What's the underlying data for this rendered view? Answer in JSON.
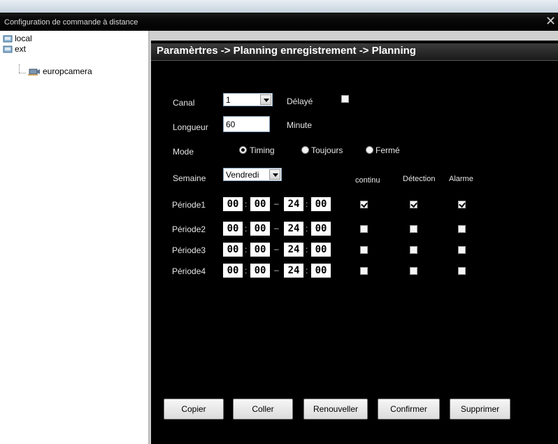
{
  "window": {
    "title": "Configuration de commande à distance",
    "close_glyph": "✕"
  },
  "tree": {
    "items": [
      {
        "label": "local",
        "icon": "folder-device-icon"
      },
      {
        "label": "ext",
        "icon": "folder-device-icon"
      },
      {
        "label": "europcamera",
        "icon": "camera-icon"
      }
    ]
  },
  "header": {
    "title": "Paramèrtres -> Planning enregistrement -> Planning"
  },
  "form": {
    "canal_label": "Canal",
    "canal_value": "1",
    "delaye_label": "Délayé",
    "delaye_checked": false,
    "longueur_label": "Longueur",
    "longueur_value": "60",
    "minute_label": "Minute",
    "mode_label": "Mode",
    "mode_options": [
      "Timing",
      "Toujours",
      "Fermé"
    ],
    "mode_selected": "Timing",
    "semaine_label": "Semaine",
    "semaine_value": "Vendredi"
  },
  "columns": {
    "continu": "continu",
    "detection": "Détection",
    "alarme": "Alarme"
  },
  "periods": [
    {
      "label": "Période1",
      "h1": "00",
      "m1": "00",
      "h2": "24",
      "m2": "00",
      "continu": true,
      "detection": true,
      "alarme": true
    },
    {
      "label": "Période2",
      "h1": "00",
      "m1": "00",
      "h2": "24",
      "m2": "00",
      "continu": false,
      "detection": false,
      "alarme": false
    },
    {
      "label": "Période3",
      "h1": "00",
      "m1": "00",
      "h2": "24",
      "m2": "00",
      "continu": false,
      "detection": false,
      "alarme": false
    },
    {
      "label": "Période4",
      "h1": "00",
      "m1": "00",
      "h2": "24",
      "m2": "00",
      "continu": false,
      "detection": false,
      "alarme": false
    }
  ],
  "time_sep": ":",
  "range_sep": "–",
  "buttons": {
    "copier": "Copier",
    "coller": "Coller",
    "renouveller": "Renouveller",
    "confirmer": "Confirmer",
    "supprimer": "Supprimer"
  }
}
